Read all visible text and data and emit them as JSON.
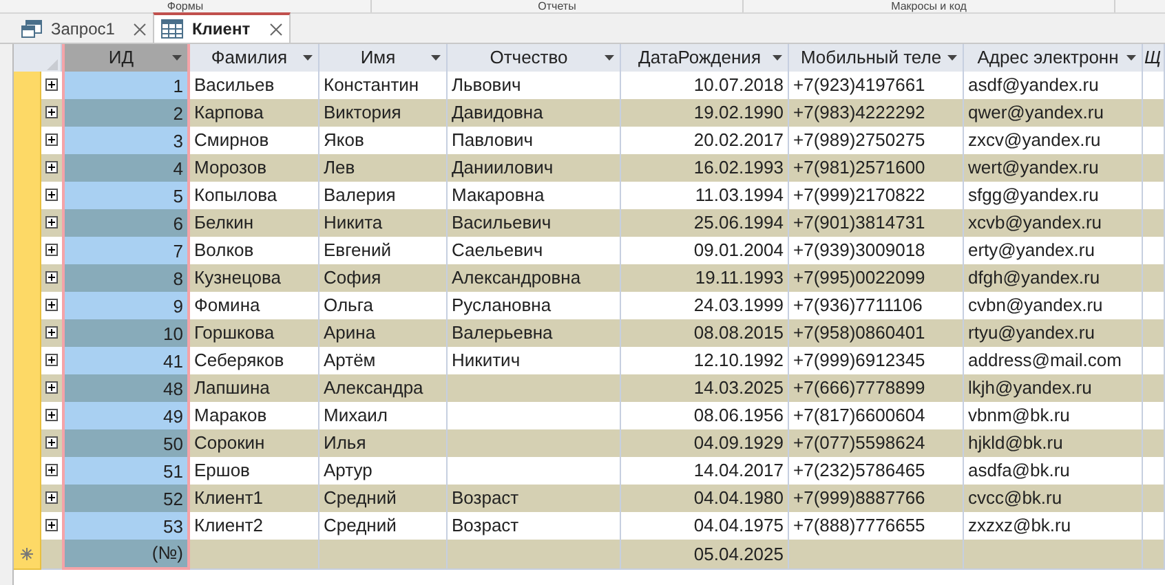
{
  "ribbon_groups": [
    "Формы",
    "Отчеты",
    "Макросы и код"
  ],
  "tabs": [
    {
      "label": "Запрос1",
      "kind": "query",
      "selected": false
    },
    {
      "label": "Клиент",
      "kind": "table",
      "selected": true
    }
  ],
  "table": {
    "columns": [
      {
        "label": "ИД",
        "selected": true
      },
      {
        "label": "Фамилия",
        "selected": false
      },
      {
        "label": "Имя",
        "selected": false
      },
      {
        "label": "Отчество",
        "selected": false
      },
      {
        "label": "ДатаРождения",
        "selected": false
      },
      {
        "label": "Мобильный теле",
        "selected": false
      },
      {
        "label": "Адрес электронн",
        "selected": false
      },
      {
        "label": "Щ",
        "selected": false
      }
    ],
    "rows": [
      {
        "kind": "record",
        "cells": [
          "1",
          "Васильев",
          "Константин",
          "Львович",
          "10.07.2018",
          "+7(923)4197661",
          "asdf@yandex.ru"
        ]
      },
      {
        "kind": "record",
        "cells": [
          "2",
          "Карпова",
          "Виктория",
          "Давидовна",
          "19.02.1990",
          "+7(983)4222292",
          "qwer@yandex.ru"
        ]
      },
      {
        "kind": "record",
        "cells": [
          "3",
          "Смирнов",
          "Яков",
          "Павлович",
          "20.02.2017",
          "+7(989)2750275",
          "zxcv@yandex.ru"
        ]
      },
      {
        "kind": "record",
        "cells": [
          "4",
          "Морозов",
          "Лев",
          "Даниилович",
          "16.02.1993",
          "+7(981)2571600",
          "wert@yandex.ru"
        ]
      },
      {
        "kind": "record",
        "cells": [
          "5",
          "Копылова",
          "Валерия",
          "Макаровна",
          "11.03.1994",
          "+7(999)2170822",
          "sfgg@yandex.ru"
        ]
      },
      {
        "kind": "record",
        "cells": [
          "6",
          "Белкин",
          "Никита",
          "Васильевич",
          "25.06.1994",
          "+7(901)3814731",
          "xcvb@yandex.ru"
        ]
      },
      {
        "kind": "record",
        "cells": [
          "7",
          "Волков",
          "Евгений",
          "Саельевич",
          "09.01.2004",
          "+7(939)3009018",
          "erty@yandex.ru"
        ]
      },
      {
        "kind": "record",
        "cells": [
          "8",
          "Кузнецова",
          "София",
          "Александровна",
          "19.11.1993",
          "+7(995)0022099",
          "dfgh@yandex.ru"
        ]
      },
      {
        "kind": "record",
        "cells": [
          "9",
          "Фомина",
          "Ольга",
          "Руслановна",
          "24.03.1999",
          "+7(936)7711106",
          "cvbn@yandex.ru"
        ]
      },
      {
        "kind": "record",
        "cells": [
          "10",
          "Горшкова",
          "Арина",
          "Валерьевна",
          "08.08.2015",
          "+7(958)0860401",
          "rtyu@yandex.ru"
        ]
      },
      {
        "kind": "record",
        "cells": [
          "41",
          "Себеряков",
          "Артём",
          "Никитич",
          "12.10.1992",
          "+7(999)6912345",
          "address@mail.com"
        ]
      },
      {
        "kind": "record",
        "cells": [
          "48",
          "Лапшина",
          "Александра",
          "",
          "14.03.2025",
          "+7(666)7778899",
          "lkjh@yandex.ru"
        ]
      },
      {
        "kind": "record",
        "cells": [
          "49",
          "Мараков",
          "Михаил",
          "",
          "08.06.1956",
          "+7(817)6600604",
          "vbnm@bk.ru"
        ]
      },
      {
        "kind": "record",
        "cells": [
          "50",
          "Сорокин",
          "Илья",
          "",
          "04.09.1929",
          "+7(077)5598624",
          "hjkld@bk.ru"
        ]
      },
      {
        "kind": "record",
        "cells": [
          "51",
          "Ершов",
          "Артур",
          "",
          "14.04.2017",
          "+7(232)5786465",
          "asdfa@bk.ru"
        ]
      },
      {
        "kind": "record",
        "cells": [
          "52",
          "Клиент1",
          "Средний",
          "Возраст",
          "04.04.1980",
          "+7(999)8887766",
          "cvcc@bk.ru"
        ]
      },
      {
        "kind": "record",
        "cells": [
          "53",
          "Клиент2",
          "Средний",
          "Возраст",
          "04.04.1975",
          "+7(888)7776655",
          "zxzxz@bk.ru"
        ]
      },
      {
        "kind": "new",
        "cells": [
          "(№)",
          "",
          "",
          "",
          "05.04.2025",
          "",
          ""
        ]
      }
    ]
  }
}
